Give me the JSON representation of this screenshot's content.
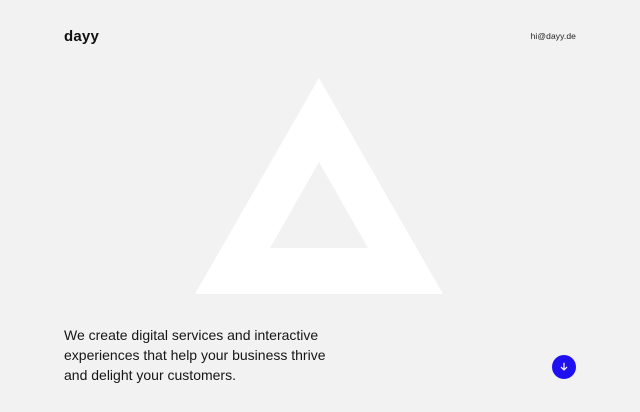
{
  "header": {
    "brand": "dayy",
    "email": "hi@dayy.de"
  },
  "hero": {
    "lines": [
      "We create digital services and interactive",
      "experiences that help your business thrive",
      "and delight your customers."
    ],
    "logo_shape": "triangle",
    "logo_color": "#ffffff"
  },
  "actions": {
    "scroll_icon": "arrow-down-icon",
    "scroll_button_color": "#1f10f2"
  },
  "theme": {
    "background": "#f2f2f2",
    "text": "#141414",
    "accent": "#1f10f2"
  }
}
